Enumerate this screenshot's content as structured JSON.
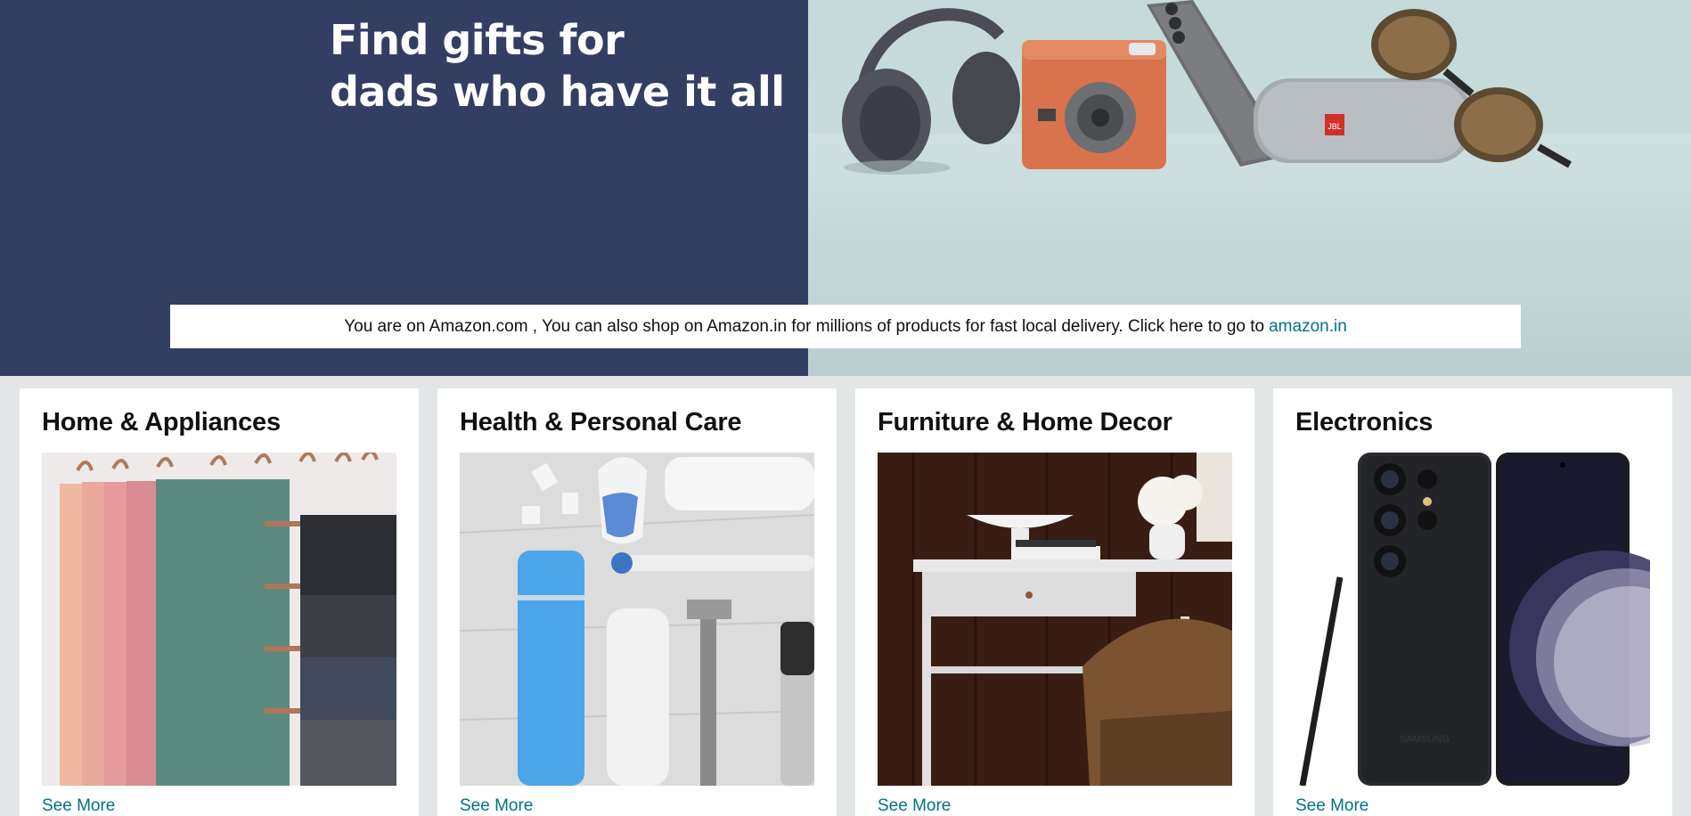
{
  "hero": {
    "headline_line1": "Find gifts for",
    "headline_line2": "dads who have it all",
    "left_bg": "#323f63"
  },
  "notice": {
    "text": "You are on Amazon.com , You can also shop on Amazon.in for millions of products for fast local delivery. Click here to go to",
    "link": "amazon.in"
  },
  "cards": [
    {
      "title": "Home & Appliances",
      "link": "See More"
    },
    {
      "title": "Health & Personal Care",
      "link": "See More"
    },
    {
      "title": "Furniture & Home Decor",
      "link": "See More"
    },
    {
      "title": "Electronics",
      "link": "See More"
    }
  ],
  "products": {
    "speaker_brand": "JBL",
    "phone_brand": "SAMSUNG"
  },
  "colors": {
    "link": "#007185",
    "page_bg": "#e3e6e6"
  }
}
